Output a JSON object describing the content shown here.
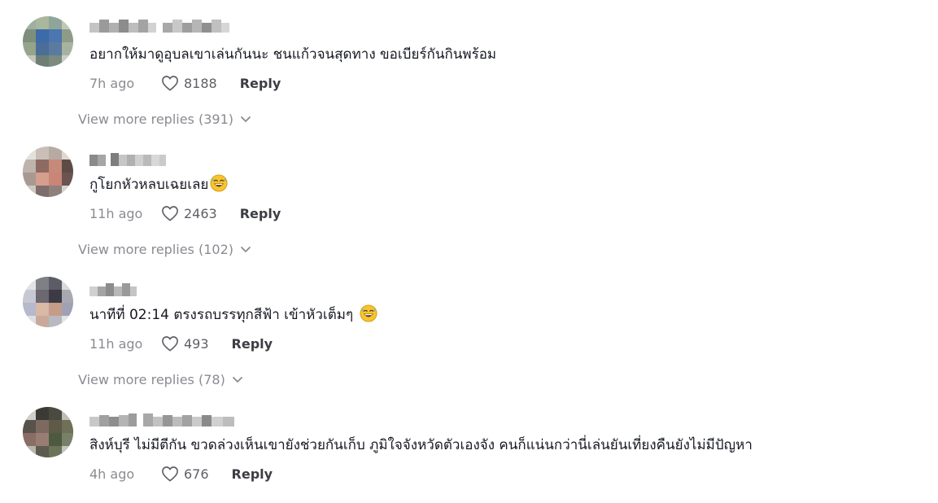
{
  "comments": [
    {
      "username_hidden": true,
      "text": "อยากให้มาดูอุบลเขาเล่นกันนะ ชนแก้วจนสุดทาง ขอเบียร์กันกินพร้อม",
      "emoji": "",
      "time": "7h ago",
      "likes": "8188",
      "reply_label": "Reply",
      "view_more": "View more replies (391)"
    },
    {
      "username_hidden": true,
      "text": "กูโยกหัวหลบเฉยเลย",
      "emoji": "grinning-sweat-face-icon",
      "time": "11h ago",
      "likes": "2463",
      "reply_label": "Reply",
      "view_more": "View more replies (102)"
    },
    {
      "username_hidden": true,
      "text": "นาทีที่ 02:14 ตรงรถบรรทุกสีฟ้า เข้าหัวเต็มๆ",
      "emoji": "grinning-sweat-face-icon",
      "time": "11h ago",
      "likes": "493",
      "reply_label": "Reply",
      "view_more": "View more replies (78)"
    },
    {
      "username_hidden": true,
      "text": "สิงห์บุรี ไม่มีตีกัน ขวดล่วงเห็นเขายังช่วยกันเก็บ ภูมิใจจังหวัดตัวเองจัง คนก็แน่นกว่านี่เล่นยันเที่ยงคืนยังไม่มีปัญหา",
      "emoji": "",
      "time": "4h ago",
      "likes": "676",
      "reply_label": "Reply",
      "view_more": ""
    }
  ],
  "icons": {
    "like": "heart-outline-icon",
    "expand": "chevron-down-icon"
  },
  "colors": {
    "text": "#161823",
    "muted": "#8a8b91",
    "reply": "#3d3e45"
  }
}
